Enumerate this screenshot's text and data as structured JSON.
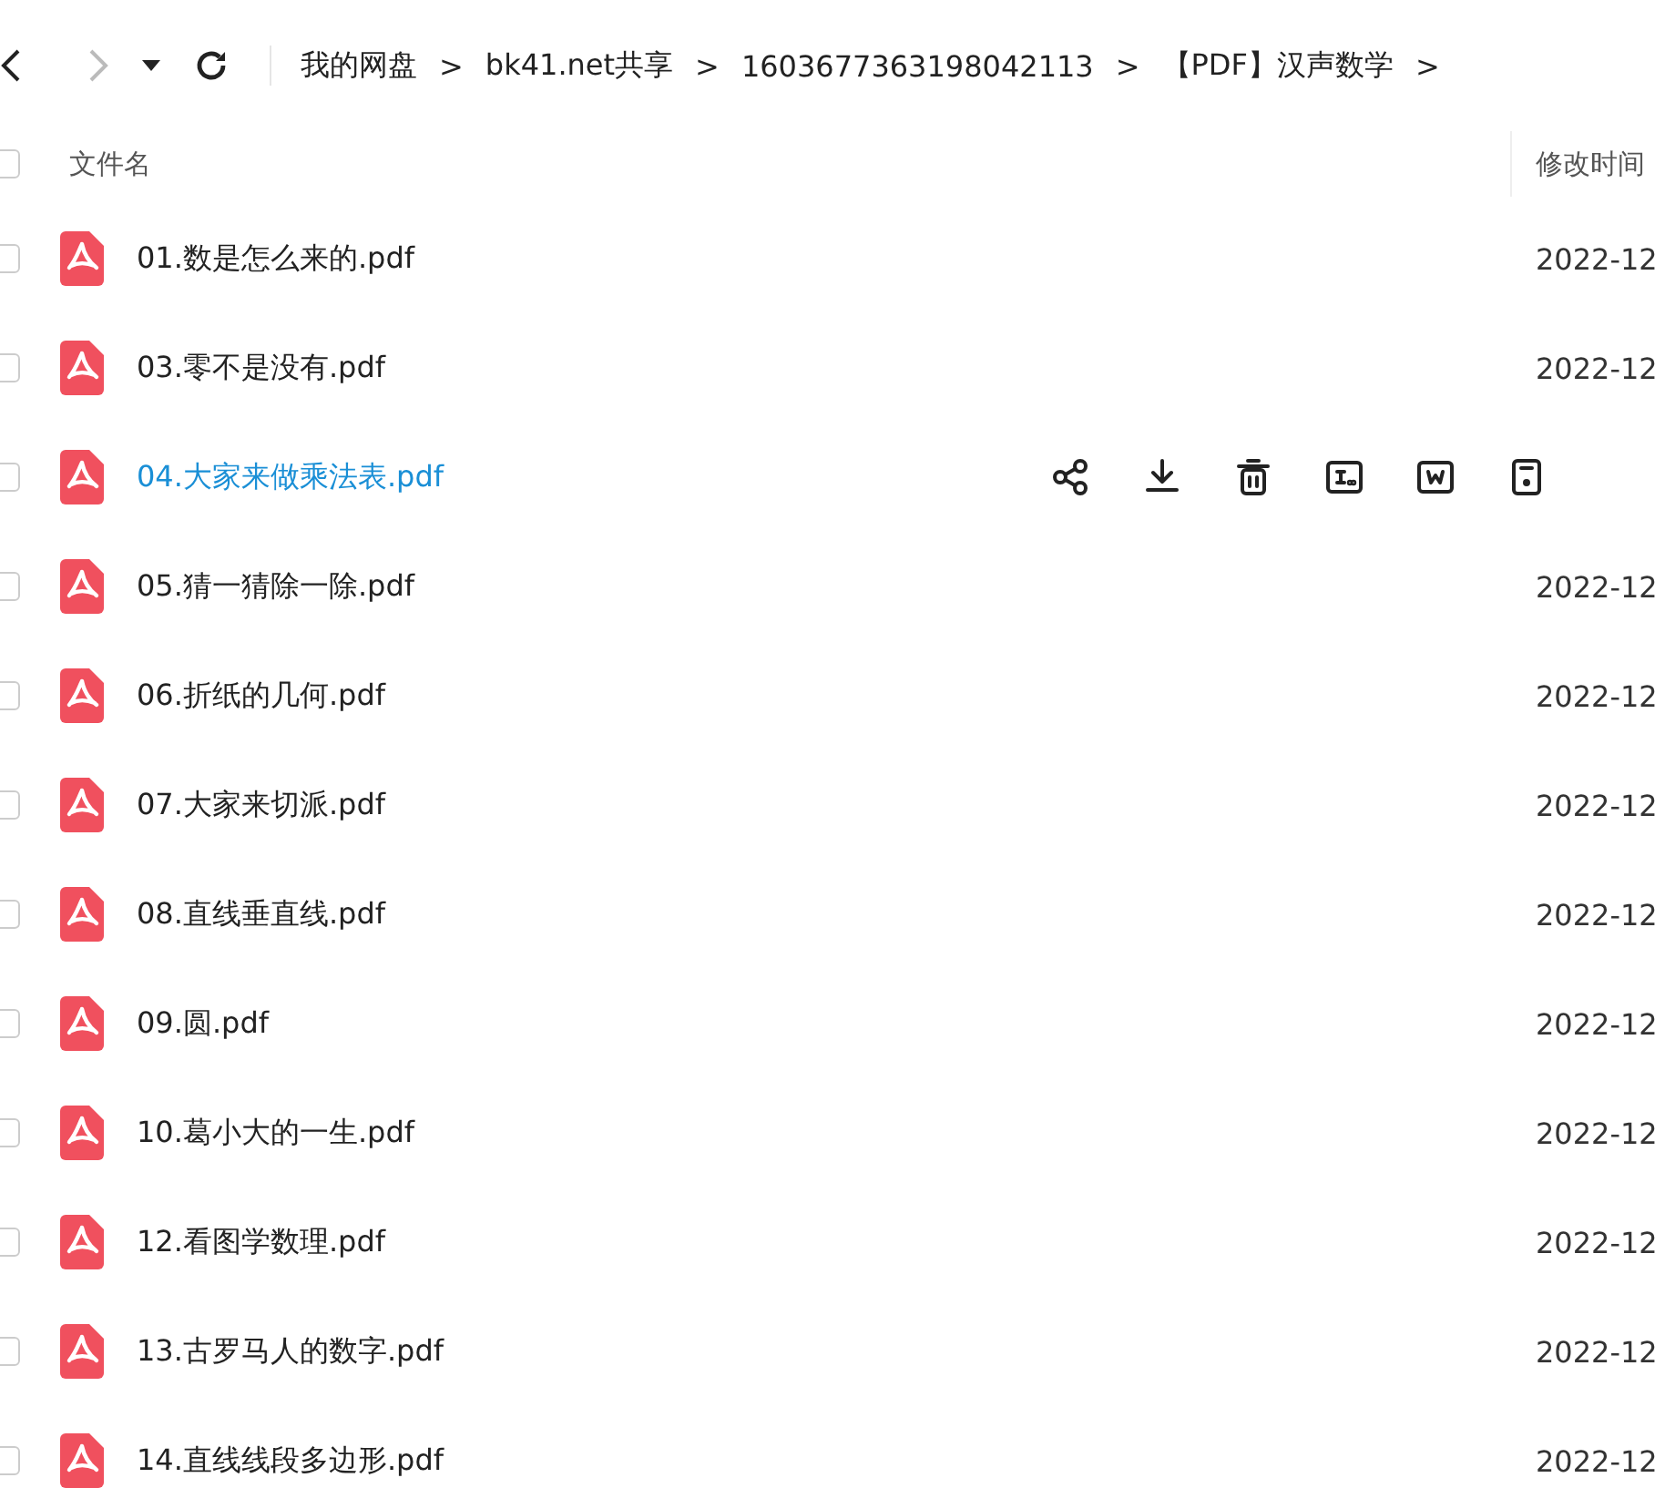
{
  "toolbar": {
    "breadcrumbs": [
      "我的网盘",
      "bk41.net共享",
      "1603677363198042113",
      "【PDF】汉声数学"
    ],
    "separator": ">"
  },
  "table": {
    "all_checked": false,
    "columns": [
      {
        "label": "文件名"
      },
      {
        "label": "修改时间"
      }
    ],
    "rows": [
      {
        "name": "01.数是怎么来的.pdf",
        "modified": "2022-12",
        "hovered": false,
        "checked": false
      },
      {
        "name": "03.零不是没有.pdf",
        "modified": "2022-12",
        "hovered": false,
        "checked": false
      },
      {
        "name": "04.大家来做乘法表.pdf",
        "hovered": true,
        "checked": false
      },
      {
        "name": "05.猜一猜除一除.pdf",
        "modified": "2022-12",
        "hovered": false,
        "checked": false
      },
      {
        "name": "06.折纸的几何.pdf",
        "modified": "2022-12",
        "hovered": false,
        "checked": false
      },
      {
        "name": "07.大家来切派.pdf",
        "modified": "2022-12",
        "hovered": false,
        "checked": false
      },
      {
        "name": "08.直线垂直线.pdf",
        "modified": "2022-12",
        "hovered": false,
        "checked": false
      },
      {
        "name": "09.圆.pdf",
        "modified": "2022-12",
        "hovered": false,
        "checked": false
      },
      {
        "name": "10.葛小大的一生.pdf",
        "modified": "2022-12",
        "hovered": false,
        "checked": false
      },
      {
        "name": "12.看图学数理.pdf",
        "modified": "2022-12",
        "hovered": false,
        "checked": false
      },
      {
        "name": "13.古罗马人的数字.pdf",
        "modified": "2022-12",
        "hovered": false,
        "checked": false
      },
      {
        "name": "14.直线线段多边形.pdf",
        "modified": "2022-12",
        "hovered": false,
        "checked": false
      }
    ]
  }
}
